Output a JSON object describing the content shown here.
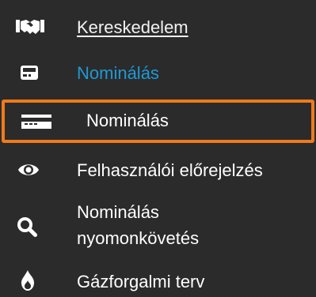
{
  "menu": {
    "items": [
      {
        "label": "Kereskedelem",
        "icon": "handshake-icon",
        "state": "parent-underlined"
      },
      {
        "label": "Nominálás",
        "icon": "credit-card-icon",
        "state": "section-active",
        "color": "#1e9ad6"
      },
      {
        "label": "Nominálás",
        "icon": "card-reader-icon",
        "state": "selected",
        "highlight_color": "#f07a1a"
      },
      {
        "label": "Felhasználói előrejelzés",
        "icon": "eye-icon"
      },
      {
        "label_line1": "Nominálás",
        "label_line2": "nyomonkövetés",
        "icon": "search-icon"
      },
      {
        "label": "Gázforgalmi terv",
        "icon": "flame-icon"
      }
    ]
  },
  "colors": {
    "background": "#2b2b2b",
    "text": "#ffffff",
    "accent_blue": "#1e9ad6",
    "selection_orange": "#f07a1a"
  }
}
